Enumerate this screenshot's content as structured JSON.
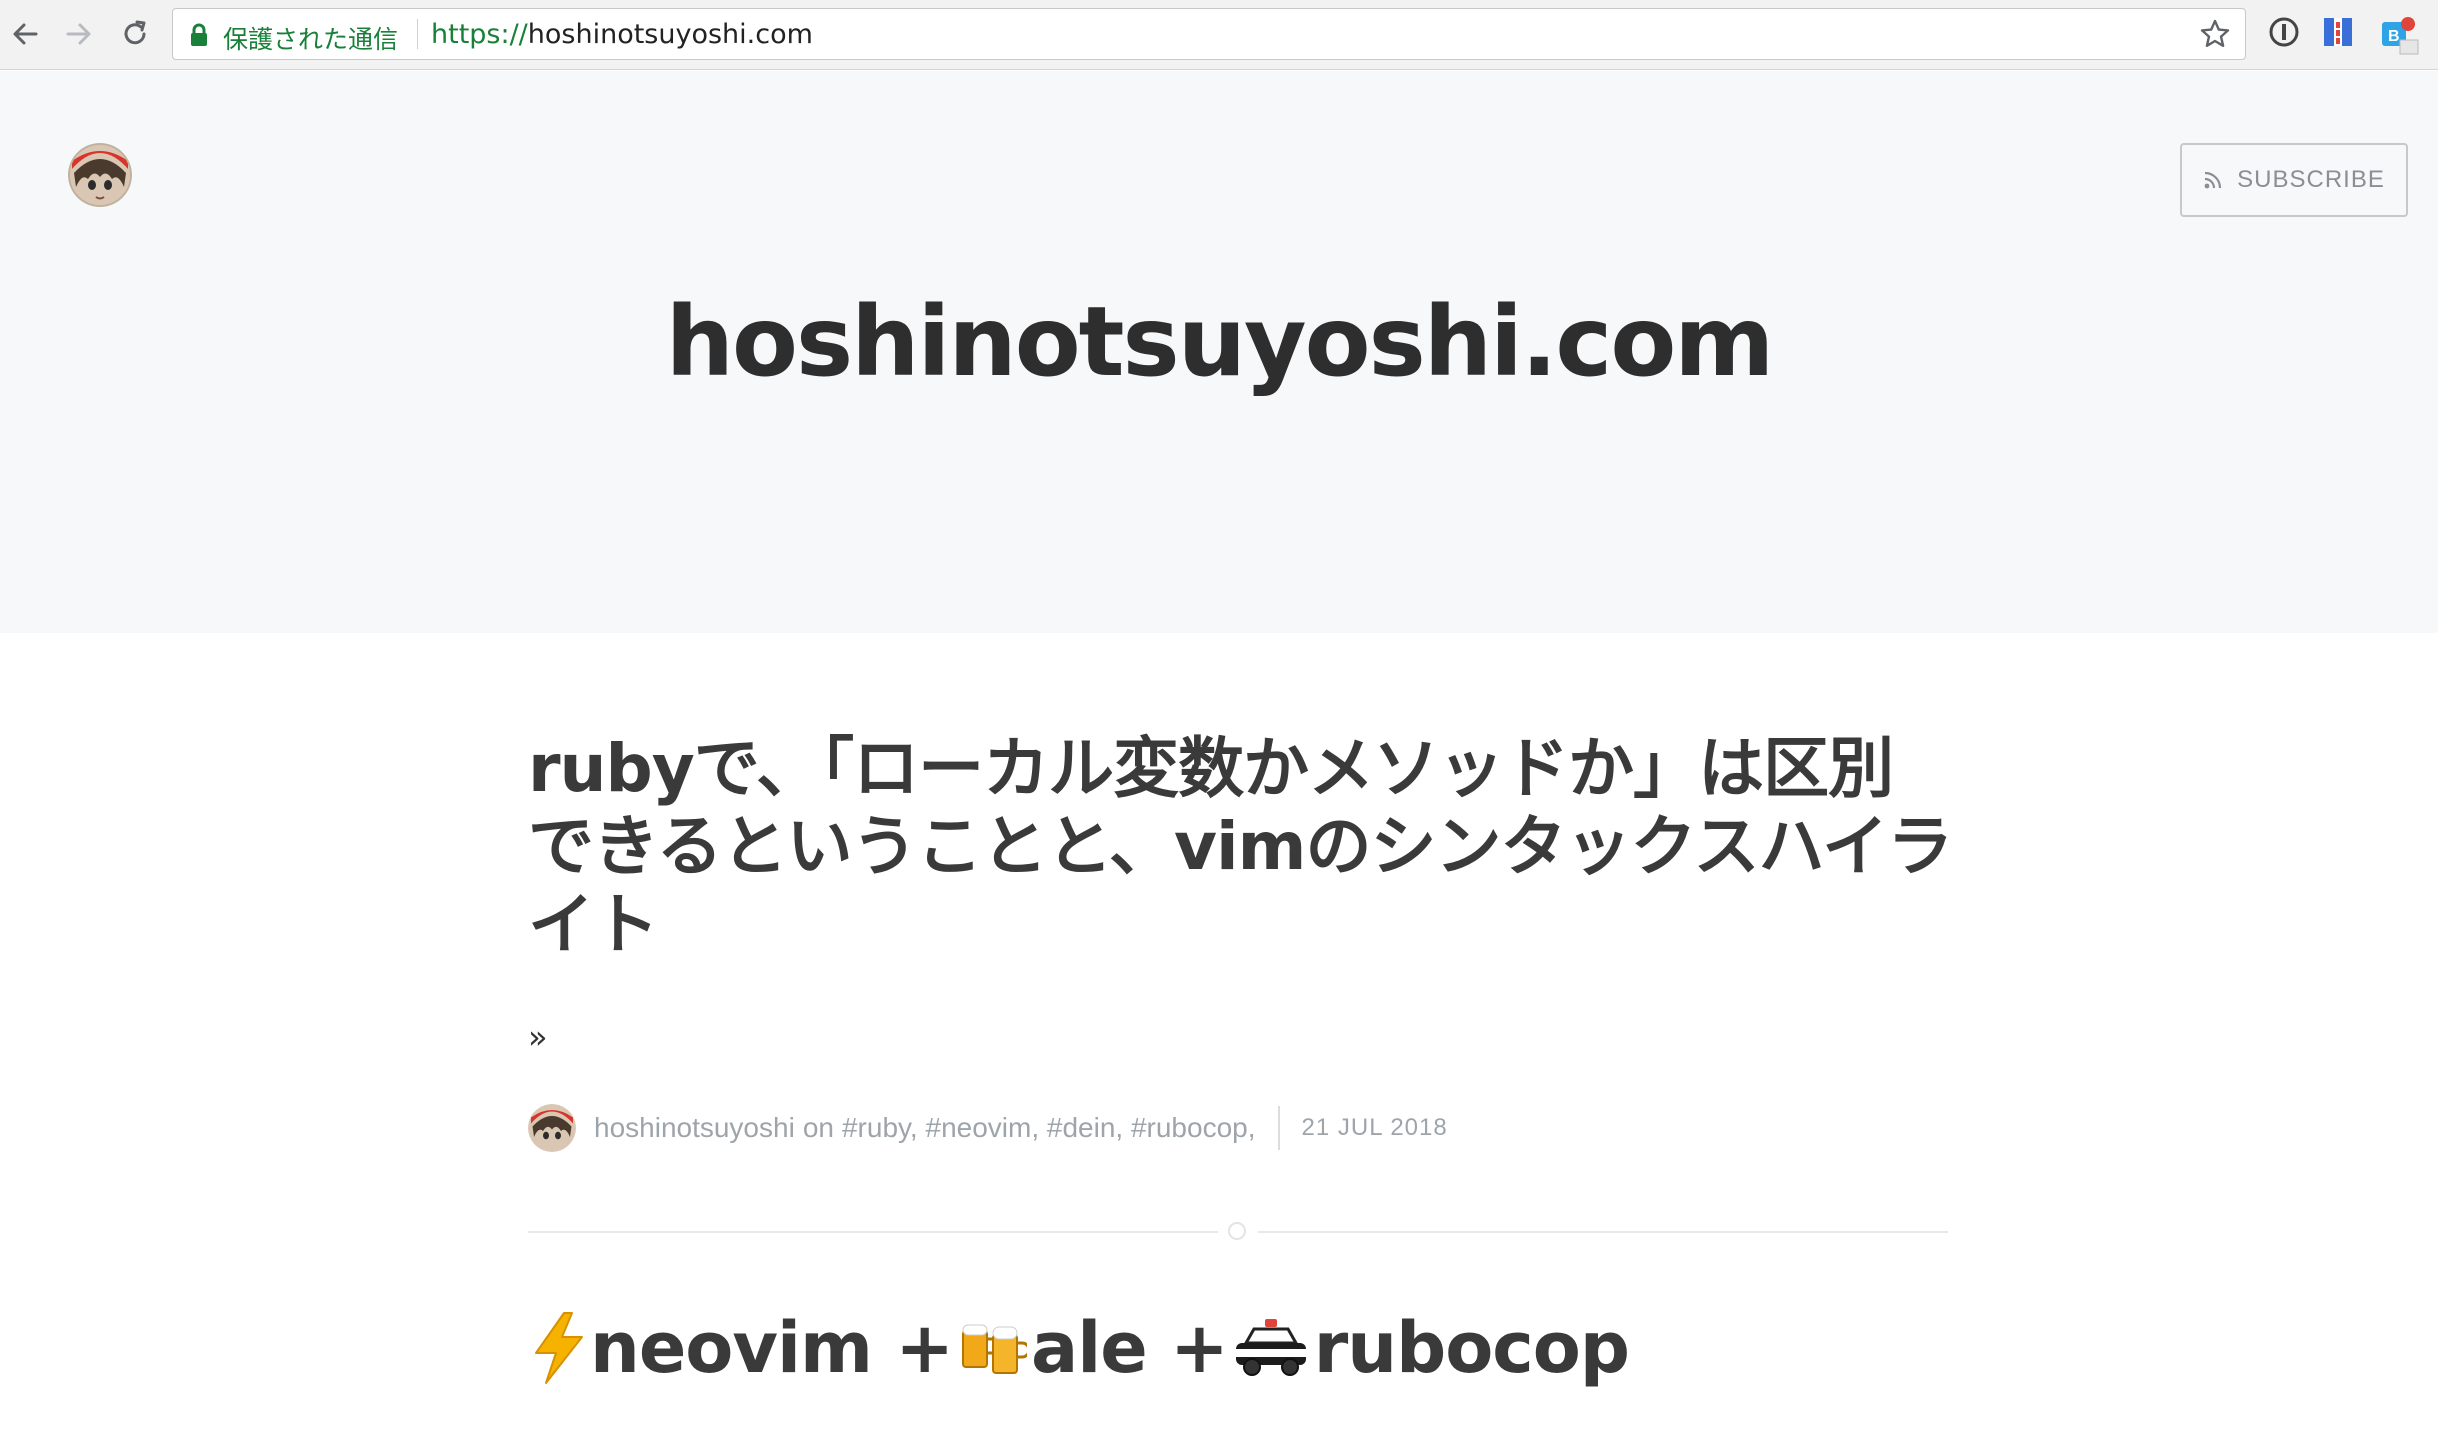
{
  "browser": {
    "secure_label": "保護された通信",
    "url_scheme": "https://",
    "url_host": "hoshinotsuyoshi.com",
    "icons": [
      "back-icon",
      "forward-icon",
      "reload-icon",
      "lock-icon",
      "star-icon",
      "extension-icon"
    ]
  },
  "header": {
    "subscribe_label": "SUBSCRIBE",
    "site_title": "hoshinotsuyoshi.com"
  },
  "post": {
    "title": "rubyで、「ローカル変数かメソッドか」は区別できるということと、vimのシンタックスハイライト",
    "excerpt": "»",
    "author": "hoshinotsuyoshi",
    "on_word": "on",
    "tags": "#ruby, #neovim, #dein, #rubocop,",
    "date": "21 JUL 2018",
    "heading_part1": "neovim + ",
    "heading_part2": "ale + ",
    "heading_part3": "rubocop"
  },
  "colors": {
    "secure_green": "#188038",
    "header_bg": "#f7f8f9",
    "title_text": "#2e2e2e",
    "meta_text": "#9ea5aa"
  }
}
